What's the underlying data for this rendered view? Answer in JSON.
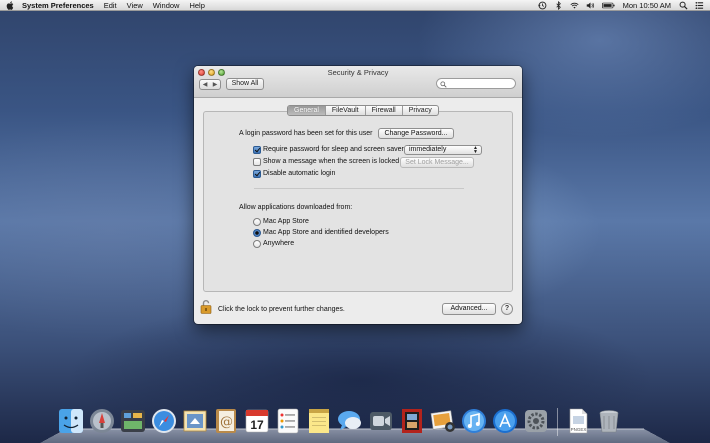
{
  "menubar": {
    "app_name": "System Preferences",
    "menus": [
      "Edit",
      "View",
      "Window",
      "Help"
    ],
    "clock": "Mon 10:50 AM"
  },
  "window": {
    "title": "Security & Privacy",
    "show_all_label": "Show All",
    "search_placeholder": "",
    "tabs": [
      "General",
      "FileVault",
      "Firewall",
      "Privacy"
    ],
    "active_tab": "General",
    "general": {
      "login_password_text": "A login password has been set for this user",
      "change_password_label": "Change Password...",
      "require_password_label": "Require password for sleep and screen saver",
      "require_password_checked": true,
      "require_password_delay": "immediately",
      "show_message_label": "Show a message when the screen is locked",
      "show_message_checked": false,
      "set_lock_message_label": "Set Lock Message...",
      "disable_auto_login_label": "Disable automatic login",
      "disable_auto_login_checked": true,
      "allow_apps_heading": "Allow applications downloaded from:",
      "allow_apps_options": [
        "Mac App Store",
        "Mac App Store and identified developers",
        "Anywhere"
      ],
      "allow_apps_selected": "Mac App Store and identified developers"
    },
    "lock_text": "Click the lock to prevent further changes.",
    "advanced_label": "Advanced...",
    "help_label": "?"
  },
  "dock": {
    "icons": [
      "finder-icon",
      "launchpad-icon",
      "mission-control-icon",
      "safari-icon",
      "mail-icon",
      "contacts-icon",
      "calendar-icon",
      "reminders-icon",
      "notes-icon",
      "messages-icon",
      "facetime-icon",
      "photo-booth-icon",
      "iphoto-icon",
      "itunes-icon",
      "app-store-icon",
      "system-preferences-icon",
      "document-icon",
      "trash-icon"
    ],
    "calendar_day": "17",
    "document_label": "PNGEX"
  }
}
